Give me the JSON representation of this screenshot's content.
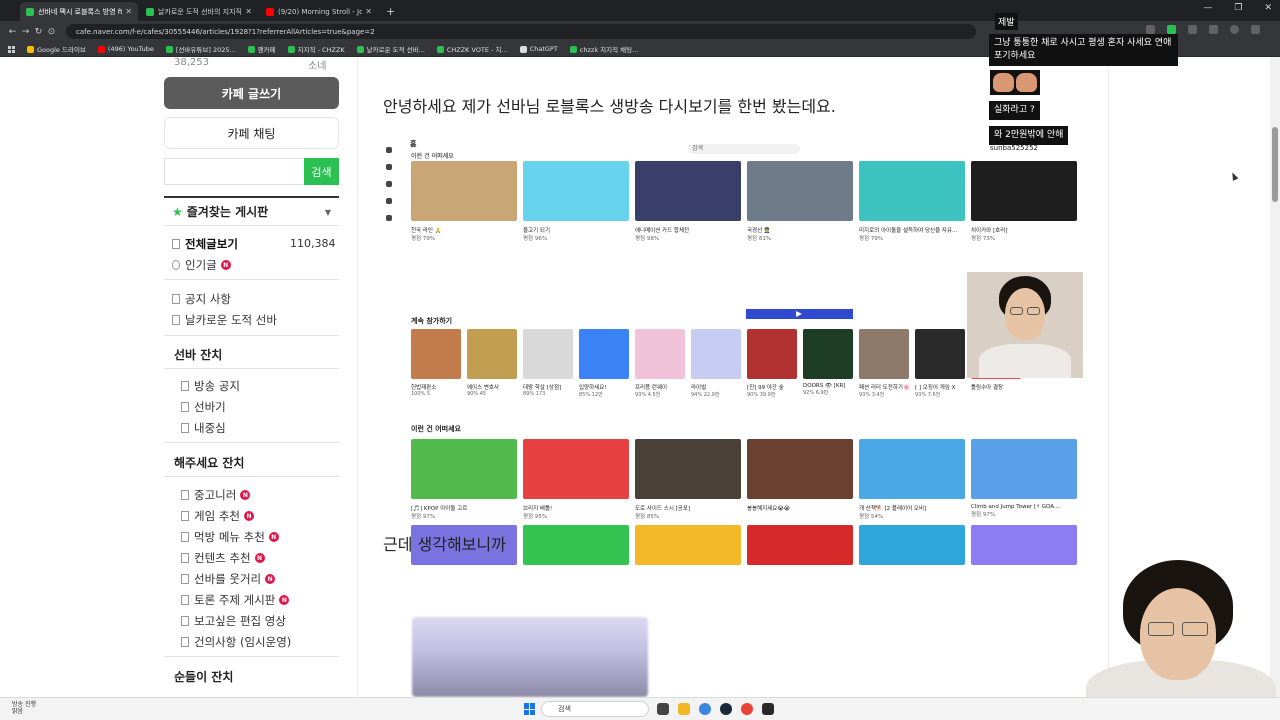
{
  "browser": {
    "tabs": [
      {
        "label": "선바네 팩시 로블록스 방영 ft",
        "active": true,
        "color": "#2ac052"
      },
      {
        "label": "날카로운 도적 선바의 지지직",
        "active": false,
        "color": "#2ac052"
      },
      {
        "label": "(9/20) Morning Stroll - Josh K",
        "active": false,
        "color": "#ff0000"
      }
    ],
    "url": "cafe.naver.com/f-e/cafes/30555446/articles/1928?1?referrerAllArticles=true&page=2",
    "bookmarks": [
      {
        "label": "Google 드라이브",
        "color": "#fbbc04"
      },
      {
        "label": "(496) YouTube",
        "color": "#ff0000"
      },
      {
        "label": "[선바유튜브] 2025...",
        "color": "#2ac052"
      },
      {
        "label": "팬카페",
        "color": "#2ac052"
      },
      {
        "label": "지지직 - CHZZK",
        "color": "#2ac052"
      },
      {
        "label": "날카로운 도적 선바...",
        "color": "#2ac052"
      },
      {
        "label": "CHZZK VOTE - 치...",
        "color": "#2ac052"
      },
      {
        "label": "ChatGPT",
        "color": "#dddddd"
      },
      {
        "label": "chzzk 치지직 채팅...",
        "color": "#2ac052"
      }
    ]
  },
  "sidebar": {
    "member_count": "38,253",
    "member_label": "소네",
    "write_button": "카페 글쓰기",
    "chat_button": "카페 채팅",
    "search_placeholder": "",
    "search_button": "검색",
    "favorites_title": "즐겨찾는 게시판",
    "all_posts": {
      "label": "전체글보기",
      "count": "110,384"
    },
    "popular": "인기글",
    "group1": [
      "공지 사항",
      "날카로운 도적 선바"
    ],
    "section_sunba": "선바 잔치",
    "sunba_items": [
      "방송 공지",
      "선바기",
      "내중심"
    ],
    "section_request": "해주세요 잔치",
    "request_items": [
      "중고니러",
      "게임 추천",
      "먹방 메뉴 추천",
      "컨텐츠 추천",
      "선바를 웃거리",
      "토론 주제 게시판",
      "보고싶은 편집 영상",
      "건의사항 (임시운영)"
    ],
    "section_sun": "순들이 잔치"
  },
  "article": {
    "para1": "안녕하세요 제가 선바님 로블록스 생방송 다시보기를 한번 봤는데요.",
    "para2": "근데 생각해보니까"
  },
  "embed": {
    "home_label": "홈",
    "search": "검색",
    "username": "sunba525252",
    "row1_label": "이런 건 어떠세요",
    "row2_label": "계속 참가하기",
    "row3_label": "이런 건 어떠세요",
    "row1": [
      {
        "title": "천국 라인 🙏",
        "stat": "평점 79%",
        "color": "#c9a675"
      },
      {
        "title": "물고기 되기",
        "stat": "평점 96%",
        "color": "#67d3ec"
      },
      {
        "title": "애니메이션 카드 합체전",
        "stat": "평점 98%",
        "color": "#3a3f6a"
      },
      {
        "title": "국경선 👮",
        "stat": "평점 81%",
        "color": "#6d7c88"
      },
      {
        "title": "미지로의 아이돌을 설득하여 당신을 자유...",
        "stat": "평점 79%",
        "color": "#3dc4c1"
      },
      {
        "title": "치이카와 [호러]",
        "stat": "평점 73%",
        "color": "#1e1e1e"
      }
    ],
    "row2": [
      {
        "title": "헌법재판소",
        "stat": "100% 5",
        "color": "#c27b4c"
      },
      {
        "title": "에이스 변호사",
        "stat": "90% 45",
        "color": "#c29e50"
      },
      {
        "title": "대왕 학살 [상점]",
        "stat": "89% 173",
        "color": "#d9d9d9"
      },
      {
        "title": "입양하세요!",
        "stat": "85% 12만",
        "color": "#3b82f6"
      },
      {
        "title": "프리픙 런웨이",
        "stat": "93% 4.5천",
        "color": "#f1c3d8"
      },
      {
        "title": "라이벌",
        "stat": "94% 22.9만",
        "color": "#c7ccf2"
      },
      {
        "title": "[진] 99 야간 숲",
        "stat": "90% 39.9만",
        "color": "#b23131"
      },
      {
        "title": "DOORS 👁 [KR]",
        "stat": "92% 6.9만",
        "color": "#1d3d25"
      },
      {
        "title": "패션 리더 도전하기🌸",
        "stat": "93% 3.4천",
        "color": "#8e7a6a"
      },
      {
        "title": "[ ] 오징어 게임 X",
        "stat": "93% 7.6천",
        "color": "#2a2a2a"
      },
      {
        "title": "틀링수아 결장",
        "stat": "",
        "color": "#e34d4d"
      }
    ],
    "row3": [
      {
        "title": "[🎵] KPOP 아이돌 고르",
        "stat": "평점 97%",
        "color": "#52b94c"
      },
      {
        "title": "브리지 배틀!",
        "stat": "평점 95%",
        "color": "#e64040"
      },
      {
        "title": "도로 사이드 스시 [공포]",
        "stat": "평점 85%",
        "color": "#4a4038"
      },
      {
        "title": "봉봉해지세요😭😭",
        "stat": "",
        "color": "#6a4030"
      },
      {
        "title": "개 산책🐕 [2 플레이어 오비]",
        "stat": "평점 54%",
        "color": "#4aa8e6"
      },
      {
        "title": "Climb and Jump Tower [⚡ GOA...",
        "stat": "평점 97%",
        "color": "#58a0e8"
      }
    ],
    "row4_colors": [
      "#7b73e0",
      "#34c250",
      "#f5b829",
      "#d62a2a",
      "#2fa5d9",
      "#8d7cf2"
    ]
  },
  "chat": {
    "name": "제발",
    "messages": [
      "그냥 퉁퉁한 채로 사시고 평생 혼자 사세요 연애 포기하세요",
      "실화라고 ?",
      "와 2만원밖에 안해"
    ]
  },
  "taskbar": {
    "weather": "방송 진행",
    "weather2": "맑음",
    "search": "검색"
  }
}
